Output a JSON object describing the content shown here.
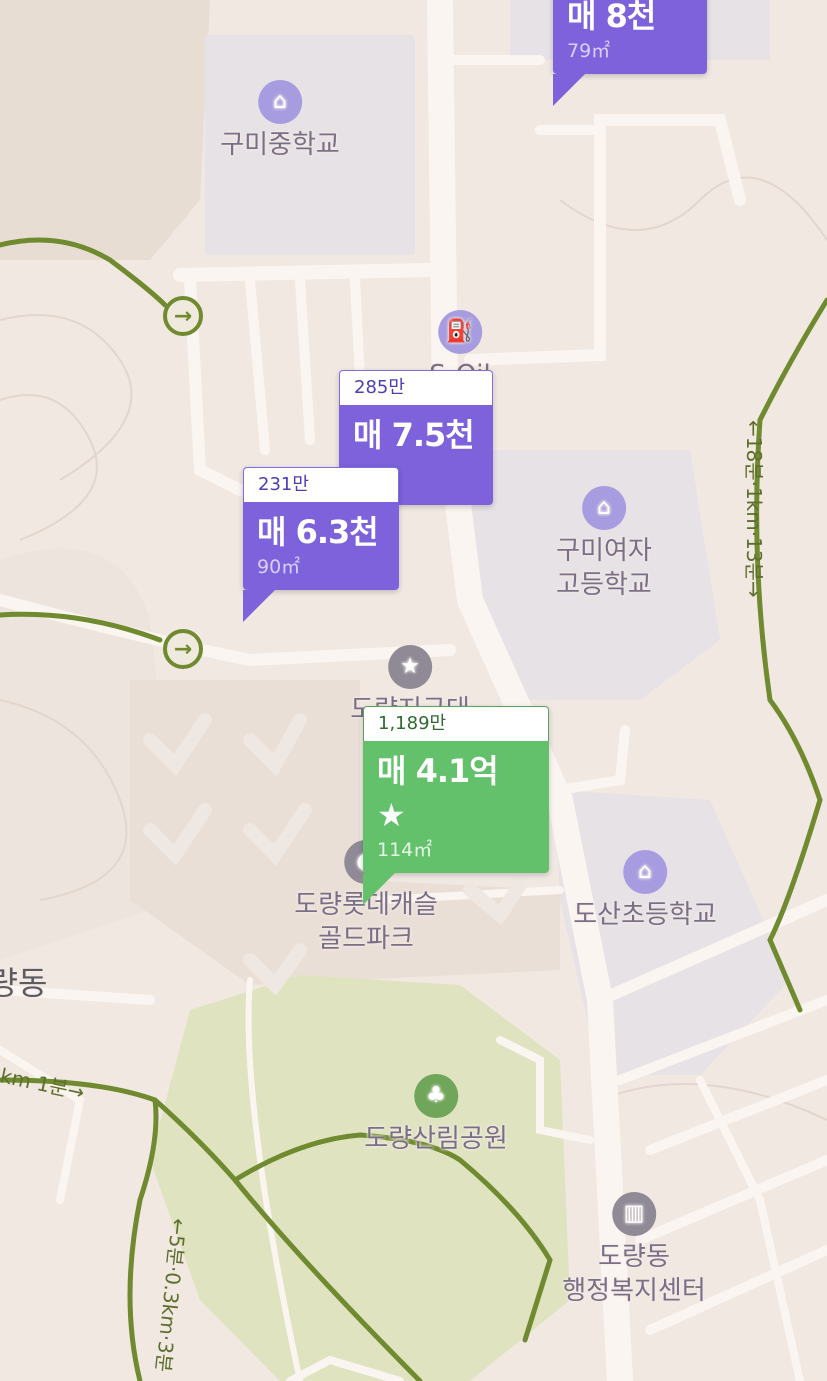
{
  "pois": {
    "gumi_middle": "구미중학교",
    "gas_station_partial": "S-Oil",
    "gumi_girls_line1": "구미여자",
    "gumi_girls_line2": "고등학교",
    "police_partial": "도량지구대",
    "golf_line1": "도량롯데캐슬",
    "golf_line2": "골드파크",
    "dosan_elem": "도산초등학교",
    "forest_park": "도량산림공원",
    "welfare_line1": "도량동",
    "welfare_line2": "행정복지센터",
    "district_partial": "량동"
  },
  "routes": {
    "right_trail": "←18분·1km·13분→",
    "left_trail": "km 1분→",
    "bottom_trail": "←5분·0.3km·3분"
  },
  "listings": [
    {
      "unit_price": "",
      "price": "매 8천",
      "area": "79㎡"
    },
    {
      "unit_price": "285만",
      "price": "매 7.5천",
      "area": ""
    },
    {
      "unit_price": "231만",
      "price": "매 6.3천",
      "area": "90㎡"
    },
    {
      "unit_price": "1,189만",
      "price": "매 4.1억",
      "area": "114㎡",
      "starred": true
    }
  ],
  "icons": {
    "school": "school-icon",
    "gas": "gas-station-icon",
    "police": "police-icon",
    "golf": "golf-icon",
    "park": "tree-icon",
    "government": "government-building-icon",
    "route_arrow": "arrow-right-circle-icon"
  },
  "colors": {
    "listing_purple": "#7d62dc",
    "listing_green": "#62c16a",
    "trail": "#6f8a2f",
    "park_area": "#dfe3c0",
    "school_area": "#e6e2e6"
  }
}
